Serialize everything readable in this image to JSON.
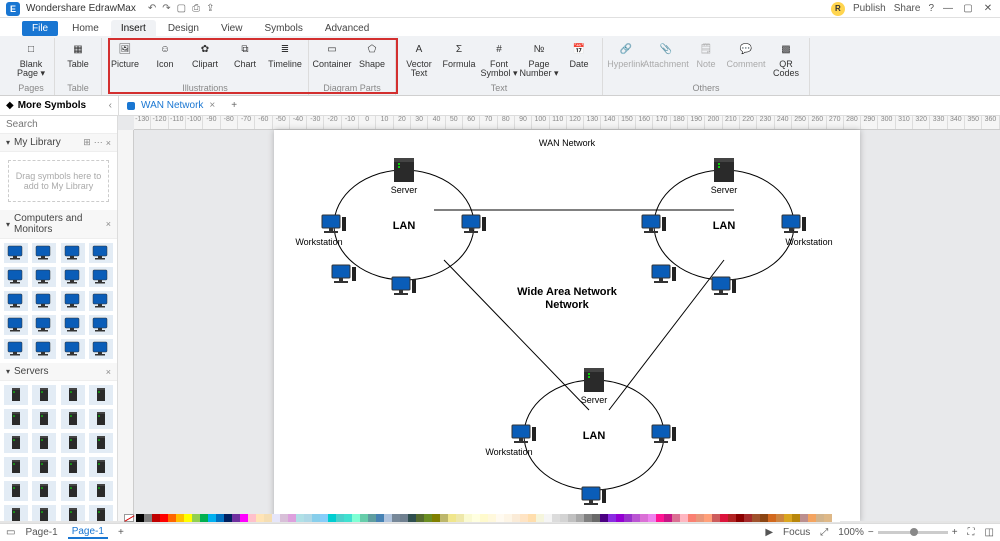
{
  "app": {
    "title": "Wondershare EdrawMax",
    "user_initial": "R",
    "publish": "Publish",
    "share": "Share"
  },
  "menu": {
    "file": "File",
    "tabs": [
      "Home",
      "Insert",
      "Design",
      "View",
      "Symbols",
      "Advanced"
    ],
    "active": "Insert"
  },
  "ribbon": {
    "groups": [
      {
        "name": "Pages",
        "items": [
          {
            "label": "Blank Page ▾",
            "icon": "□"
          }
        ]
      },
      {
        "name": "Table",
        "items": [
          {
            "label": "Table",
            "icon": "▦"
          }
        ]
      },
      {
        "name": "Illustrations",
        "highlight": true,
        "items": [
          {
            "label": "Picture",
            "icon": "🖼"
          },
          {
            "label": "Icon",
            "icon": "☺"
          },
          {
            "label": "Clipart",
            "icon": "✿"
          },
          {
            "label": "Chart",
            "icon": "⧉"
          },
          {
            "label": "Timeline",
            "icon": "≣"
          }
        ]
      },
      {
        "name": "Diagram Parts",
        "highlight": true,
        "items": [
          {
            "label": "Container",
            "icon": "▭"
          },
          {
            "label": "Shape",
            "icon": "⬠"
          }
        ]
      },
      {
        "name": "Text",
        "items": [
          {
            "label": "Vector Text",
            "icon": "A"
          },
          {
            "label": "Formula",
            "icon": "Σ"
          },
          {
            "label": "Font Symbol ▾",
            "icon": "#"
          },
          {
            "label": "Page Number ▾",
            "icon": "№"
          },
          {
            "label": "Date",
            "icon": "📅"
          }
        ]
      },
      {
        "name": "Others",
        "items": [
          {
            "label": "Hyperlink",
            "icon": "🔗",
            "disabled": true
          },
          {
            "label": "Attachment",
            "icon": "📎",
            "disabled": true
          },
          {
            "label": "Note",
            "icon": "🗒",
            "disabled": true
          },
          {
            "label": "Comment",
            "icon": "💬",
            "disabled": true
          },
          {
            "label": "QR Codes",
            "icon": "▩"
          }
        ]
      }
    ]
  },
  "more_symbols": "More Symbols",
  "doc_tab": "WAN Network",
  "sidebar": {
    "search_placeholder": "Search",
    "mylib": "My Library",
    "dropzone": "Drag symbols here to add to My Library",
    "cat1": "Computers and Monitors",
    "cat2": "Servers"
  },
  "diagram": {
    "title": "WAN Network",
    "center": "Wide Area Network",
    "lan": "LAN",
    "server": "Server",
    "workstation": "Workstation"
  },
  "ruler_h": [
    "-130",
    "-120",
    "-110",
    "-100",
    "-90",
    "-80",
    "-70",
    "-60",
    "-50",
    "-40",
    "-30",
    "-20",
    "-10",
    "0",
    "10",
    "20",
    "30",
    "40",
    "50",
    "60",
    "70",
    "80",
    "90",
    "100",
    "110",
    "120",
    "130",
    "140",
    "150",
    "160",
    "170",
    "180",
    "190",
    "200",
    "210",
    "220",
    "230",
    "240",
    "250",
    "260",
    "270",
    "280",
    "290",
    "300",
    "310",
    "320",
    "330",
    "340",
    "350",
    "360"
  ],
  "status": {
    "page": "Page-1",
    "focus": "Focus",
    "zoom": "100%"
  },
  "colors": [
    "#000000",
    "#7f7f7f",
    "#c00000",
    "#ff0000",
    "#ff6600",
    "#ffc000",
    "#ffff00",
    "#92d050",
    "#00b050",
    "#00b0f0",
    "#0070c0",
    "#002060",
    "#7030a0",
    "#ff00ff",
    "#ffc0cb",
    "#ffe4b5",
    "#f5deb3",
    "#e6e6fa",
    "#d8bfd8",
    "#dda0dd",
    "#b0e0e6",
    "#add8e6",
    "#87ceeb",
    "#87cefa",
    "#00ced1",
    "#48d1cc",
    "#40e0d0",
    "#7fffd4",
    "#66cdaa",
    "#5f9ea0",
    "#4682b4",
    "#b0c4de",
    "#778899",
    "#708090",
    "#2f4f4f",
    "#556b2f",
    "#6b8e23",
    "#808000",
    "#bdb76b",
    "#f0e68c",
    "#eee8aa",
    "#fafad2",
    "#ffffe0",
    "#fffacd",
    "#fff8dc",
    "#fffaf0",
    "#fdf5e6",
    "#faebd7",
    "#ffe4c4",
    "#ffdead",
    "#f5f5dc",
    "#f5f5f5",
    "#dcdcdc",
    "#d3d3d3",
    "#c0c0c0",
    "#a9a9a9",
    "#808080",
    "#696969",
    "#4b0082",
    "#8a2be2",
    "#9400d3",
    "#9932cc",
    "#ba55d3",
    "#da70d6",
    "#ee82ee",
    "#ff1493",
    "#c71585",
    "#db7093",
    "#ffb6c1",
    "#fa8072",
    "#e9967a",
    "#ffa07a",
    "#cd5c5c",
    "#dc143c",
    "#b22222",
    "#8b0000",
    "#a52a2a",
    "#a0522d",
    "#8b4513",
    "#d2691e",
    "#cd853f",
    "#daa520",
    "#b8860b",
    "#bc8f8f",
    "#f4a460",
    "#d2b48c",
    "#deb887",
    "#ffffff"
  ]
}
